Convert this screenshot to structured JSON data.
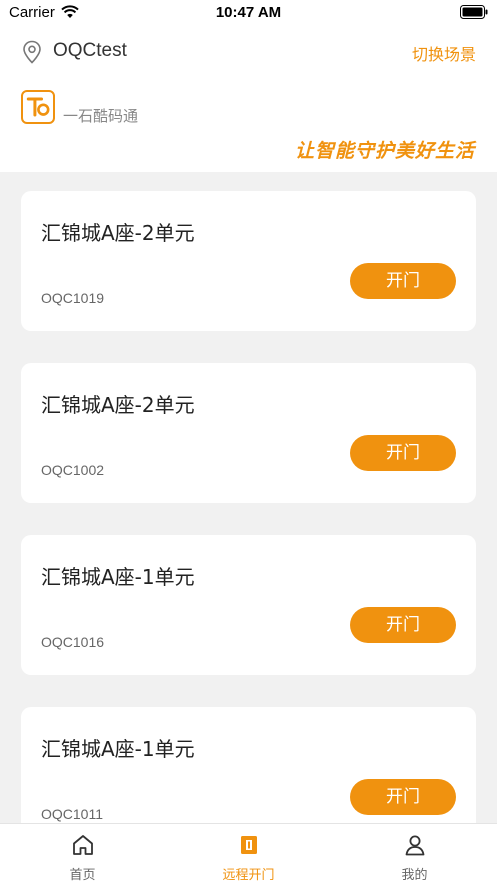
{
  "status_bar": {
    "carrier": "Carrier",
    "time": "10:47 AM"
  },
  "header": {
    "location_name": "OQCtest",
    "switch_label": "切换场景",
    "brand_name": "一石酷码通",
    "slogan": "让智能守护美好生活"
  },
  "colors": {
    "accent": "#f0920f",
    "background": "#f1f1f1"
  },
  "doors": [
    {
      "title": "汇锦城A座-2单元",
      "code": "OQC1019",
      "button_label": "开门"
    },
    {
      "title": "汇锦城A座-2单元",
      "code": "OQC1002",
      "button_label": "开门"
    },
    {
      "title": "汇锦城A座-1单元",
      "code": "OQC1016",
      "button_label": "开门"
    },
    {
      "title": "汇锦城A座-1单元",
      "code": "OQC1011",
      "button_label": "开门"
    }
  ],
  "tabs": [
    {
      "label": "首页",
      "icon": "home-icon",
      "active": false
    },
    {
      "label": "远程开门",
      "icon": "door-icon",
      "active": true
    },
    {
      "label": "我的",
      "icon": "user-icon",
      "active": false
    }
  ]
}
